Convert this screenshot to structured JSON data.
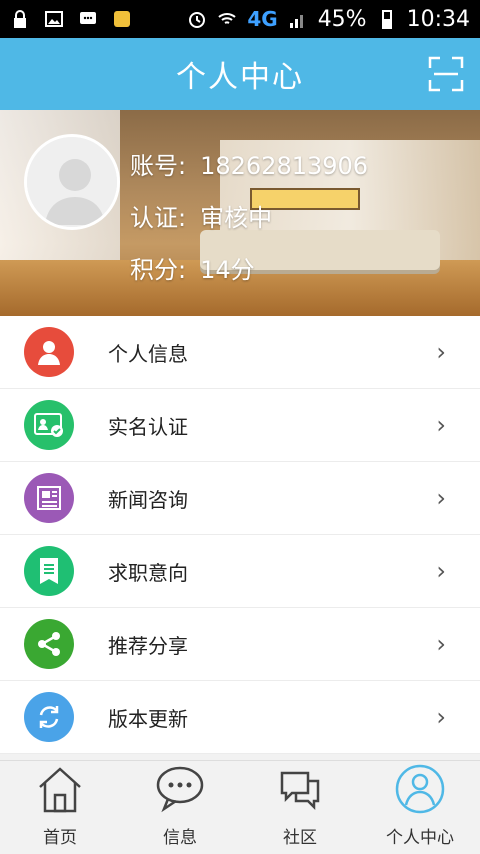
{
  "status_bar": {
    "battery_percent": "45%",
    "time": "10:34",
    "network": "4G"
  },
  "header": {
    "title": "个人中心",
    "scan_icon": "scan-icon"
  },
  "profile": {
    "account_label": "账号:",
    "account_value": "18262813906",
    "verify_label": "认证:",
    "verify_value": "审核中",
    "points_label": "积分:",
    "points_value": "14分"
  },
  "menu": [
    {
      "label": "个人信息",
      "icon": "person-icon",
      "color": "#e74c3c"
    },
    {
      "label": "实名认证",
      "icon": "id-card-icon",
      "color": "#27c06b"
    },
    {
      "label": "新闻咨询",
      "icon": "news-icon",
      "color": "#9b59b6"
    },
    {
      "label": "求职意向",
      "icon": "list-icon",
      "color": "#1fbf73"
    },
    {
      "label": "推荐分享",
      "icon": "share-icon",
      "color": "#3aa832"
    },
    {
      "label": "版本更新",
      "icon": "refresh-icon",
      "color": "#4aa3e8"
    }
  ],
  "tabs": [
    {
      "label": "首页",
      "icon": "home-icon"
    },
    {
      "label": "信息",
      "icon": "chat-bubble-icon"
    },
    {
      "label": "社区",
      "icon": "community-icon"
    },
    {
      "label": "个人中心",
      "icon": "profile-icon"
    }
  ],
  "colors": {
    "accent": "#4fb8e6"
  }
}
